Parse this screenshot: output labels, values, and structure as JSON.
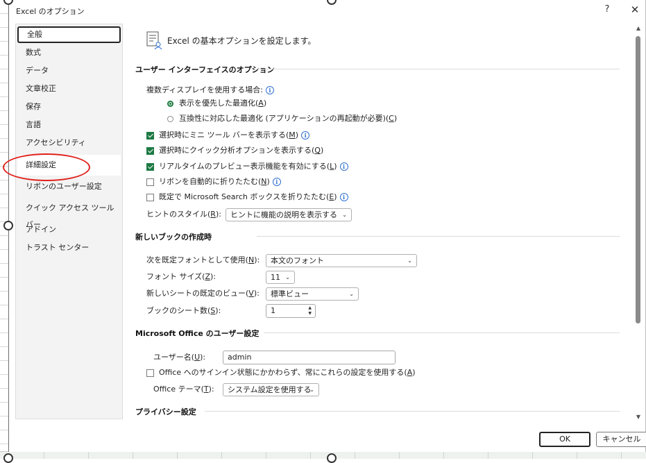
{
  "window": {
    "title": "Excel のオプション",
    "help": "?",
    "close": "✕"
  },
  "sidebar": {
    "items": [
      {
        "label": "全般"
      },
      {
        "label": "数式"
      },
      {
        "label": "データ"
      },
      {
        "label": "文章校正"
      },
      {
        "label": "保存"
      },
      {
        "label": "言語"
      },
      {
        "label": "アクセシビリティ"
      },
      {
        "label": "詳細設定"
      },
      {
        "label": "リボンのユーザー設定"
      },
      {
        "label": "クイック アクセス ツール バー"
      },
      {
        "label": "アドイン"
      },
      {
        "label": "トラスト センター"
      }
    ]
  },
  "main": {
    "header": "Excel の基本オプションを設定します。",
    "ui_section": {
      "title": "ユーザー インターフェイスのオプション",
      "multi_display_label": "複数ディスプレイを使用する場合:",
      "radio_display": "表示を優先した最適化(",
      "radio_display_key": "A",
      "radio_compat": "互換性に対応した最適化 (アプリケーションの再起動が必要)(",
      "radio_compat_key": "C",
      "mini_toolbar": "選択時にミニ ツール バーを表示する(",
      "mini_toolbar_key": "M",
      "quick_analysis": "選択時にクイック分析オプションを表示する(",
      "quick_analysis_key": "Q",
      "live_preview": "リアルタイムのプレビュー表示機能を有効にする(",
      "live_preview_key": "L",
      "collapse_ribbon": "リボンを自動的に折りたたむ(",
      "collapse_ribbon_key": "N",
      "collapse_search": "既定で Microsoft Search ボックスを折りたたむ(",
      "collapse_search_key": "E",
      "tooltip_style_label": "ヒントのスタイル(",
      "tooltip_style_key": "R",
      "tooltip_style_value": "ヒントに機能の説明を表示する"
    },
    "workbook_section": {
      "title": "新しいブックの作成時",
      "font_label": "次を既定フォントとして使用(",
      "font_key": "N",
      "font_value": "本文のフォント",
      "size_label": "フォント サイズ(",
      "size_key": "Z",
      "size_value": "11",
      "view_label": "新しいシートの既定のビュー(",
      "view_key": "V",
      "view_value": "標準ビュー",
      "sheets_label": "ブックのシート数(",
      "sheets_key": "S",
      "sheets_value": "1"
    },
    "office_section": {
      "title": "Microsoft Office のユーザー設定",
      "username_label": "ユーザー名(",
      "username_key": "U",
      "username_value": "admin",
      "always_use_label": "Office へのサインイン状態にかかわらず、常にこれらの設定を使用する(",
      "always_use_key": "A",
      "theme_label": "Office テーマ(",
      "theme_key": "T",
      "theme_value": "システム設定を使用する"
    },
    "privacy_section": {
      "title": "プライバシー設定"
    }
  },
  "buttons": {
    "ok": "OK",
    "cancel": "キャンセル"
  },
  "colors": {
    "annotation": "#e0201a",
    "checkbox": "#1d7a44"
  }
}
